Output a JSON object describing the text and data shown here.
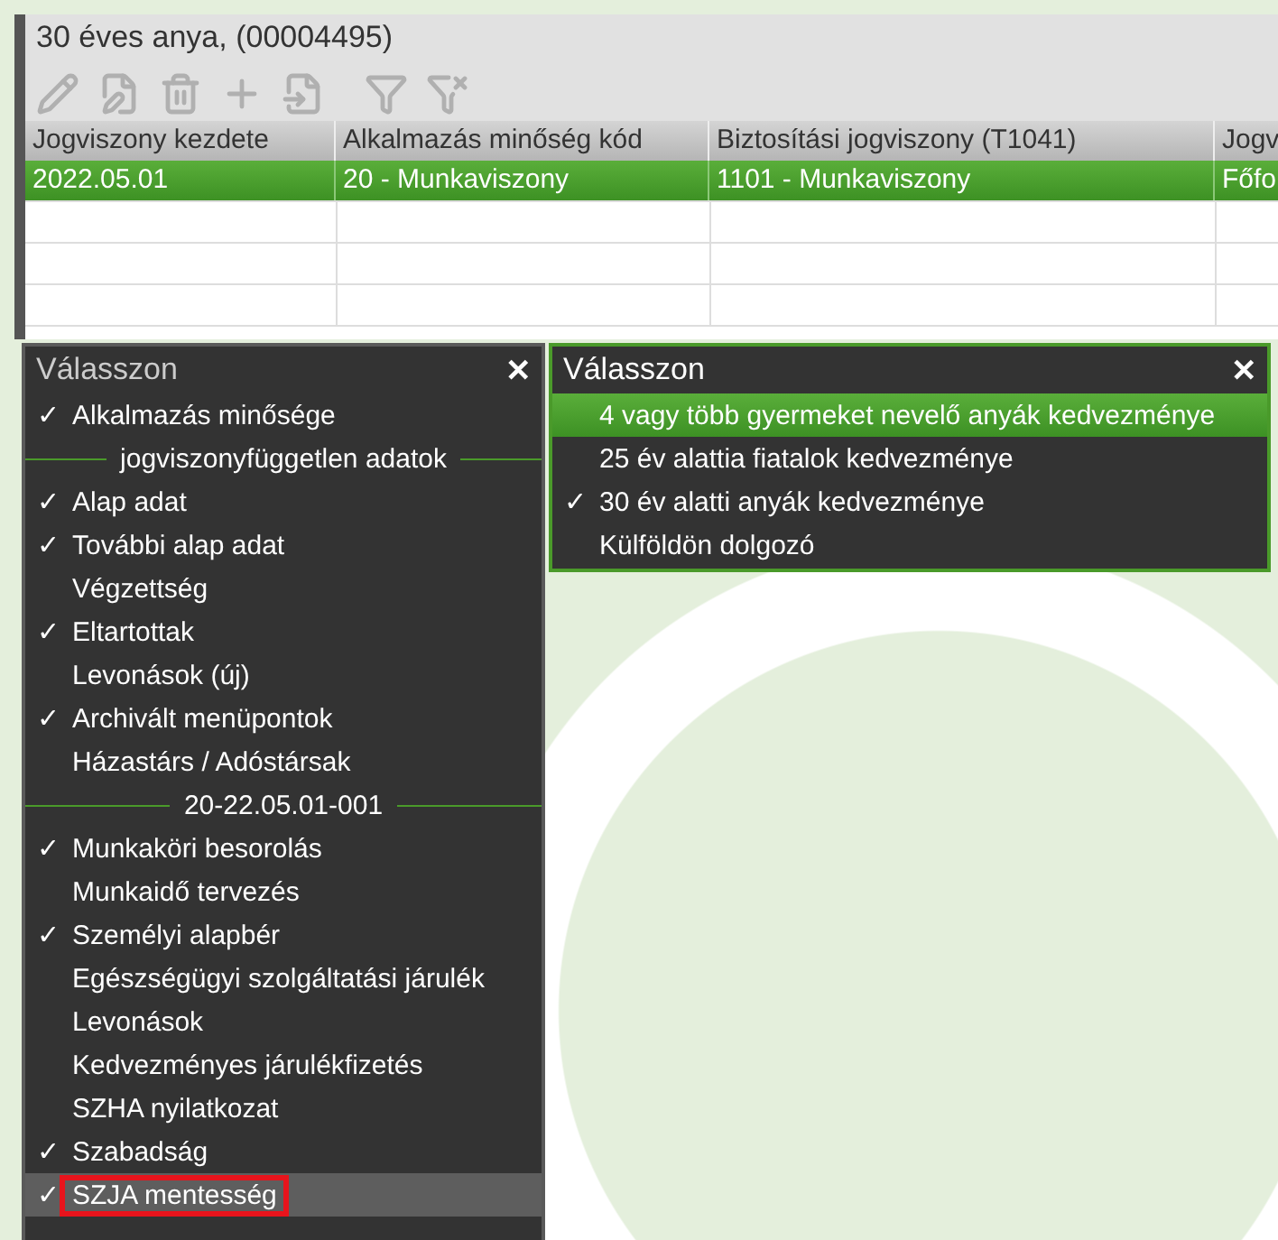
{
  "panel": {
    "title": "30 éves anya, (00004495)",
    "toolbar": [
      {
        "kind": "pencil"
      },
      {
        "kind": "edit"
      },
      {
        "kind": "trash"
      },
      {
        "kind": "plus"
      },
      {
        "kind": "import"
      },
      {
        "kind": "filter"
      },
      {
        "kind": "filter-clear"
      }
    ],
    "table": {
      "columns": [
        "Jogviszony kezdete",
        "Alkalmazás minőség kód",
        "Biztosítási jogviszony (T1041)",
        "Jogv"
      ],
      "rows": [
        {
          "selected": true,
          "cells": [
            "2022.05.01",
            "20 - Munkaviszony",
            "1101 - Munkaviszony",
            "Főfo"
          ]
        },
        {
          "selected": false,
          "cells": []
        },
        {
          "selected": false,
          "cells": []
        },
        {
          "selected": false,
          "cells": []
        }
      ]
    }
  },
  "menu_left": {
    "title": "Válasszon",
    "close": "✕",
    "check": "✓",
    "items": [
      {
        "kind": "item",
        "label": "Alkalmazás minősége",
        "checked": true,
        "selected": false,
        "annotated": false
      },
      {
        "kind": "section",
        "label": "jogviszonyfüggetlen adatok"
      },
      {
        "kind": "item",
        "label": "Alap adat",
        "checked": true,
        "selected": false,
        "annotated": false
      },
      {
        "kind": "item",
        "label": "További alap adat",
        "checked": true,
        "selected": false,
        "annotated": false
      },
      {
        "kind": "item",
        "label": "Végzettség",
        "checked": false,
        "selected": false,
        "annotated": false
      },
      {
        "kind": "item",
        "label": "Eltartottak",
        "checked": true,
        "selected": false,
        "annotated": false
      },
      {
        "kind": "item",
        "label": "Levonások (új)",
        "checked": false,
        "selected": false,
        "annotated": false
      },
      {
        "kind": "item",
        "label": "Archivált menüpontok",
        "checked": true,
        "selected": false,
        "annotated": false
      },
      {
        "kind": "item",
        "label": "Házastárs / Adóstársak",
        "checked": false,
        "selected": false,
        "annotated": false
      },
      {
        "kind": "section",
        "label": "20-22.05.01-001"
      },
      {
        "kind": "item",
        "label": "Munkaköri besorolás",
        "checked": true,
        "selected": false,
        "annotated": false
      },
      {
        "kind": "item",
        "label": "Munkaidő tervezés",
        "checked": false,
        "selected": false,
        "annotated": false
      },
      {
        "kind": "item",
        "label": "Személyi alapbér",
        "checked": true,
        "selected": false,
        "annotated": false
      },
      {
        "kind": "item",
        "label": "Egészségügyi szolgáltatási járulék",
        "checked": false,
        "selected": false,
        "annotated": false
      },
      {
        "kind": "item",
        "label": "Levonások",
        "checked": false,
        "selected": false,
        "annotated": false
      },
      {
        "kind": "item",
        "label": "Kedvezményes járulékfizetés",
        "checked": false,
        "selected": false,
        "annotated": false
      },
      {
        "kind": "item",
        "label": "SZHA nyilatkozat",
        "checked": false,
        "selected": false,
        "annotated": false
      },
      {
        "kind": "item",
        "label": "Szabadság",
        "checked": true,
        "selected": false,
        "annotated": false
      },
      {
        "kind": "item",
        "label": "SZJA mentesség",
        "checked": true,
        "selected": true,
        "annotated": true
      }
    ]
  },
  "menu_right": {
    "title": "Válasszon",
    "close": "✕",
    "check": "✓",
    "items": [
      {
        "label": "4 vagy több gyermeket nevelő anyák kedvezménye",
        "checked": false,
        "selected": true
      },
      {
        "label": "25 év alattia fiatalok kedvezménye",
        "checked": false,
        "selected": false
      },
      {
        "label": "30 év alatti anyák kedvezménye",
        "checked": true,
        "selected": false
      },
      {
        "label": "Külföldön dolgozó",
        "checked": false,
        "selected": false
      }
    ]
  }
}
